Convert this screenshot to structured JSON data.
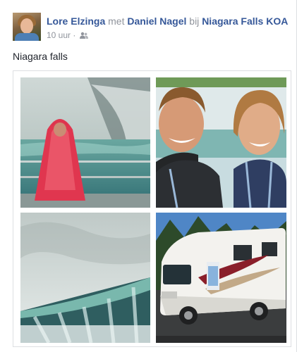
{
  "post": {
    "author": "Lore Elzinga",
    "with_word": "met",
    "tagged": "Daniel Nagel",
    "at_word": "bij",
    "location": "Niagara Falls KOA",
    "time": "10 uur",
    "separator": "·",
    "privacy_icon": "friends-icon",
    "caption": "Niagara falls"
  },
  "photos": [
    {
      "name": "photo-poncho-falls"
    },
    {
      "name": "photo-couple-selfie"
    },
    {
      "name": "photo-horseshoe-falls"
    },
    {
      "name": "photo-rv-camper"
    }
  ],
  "colors": {
    "link": "#365899",
    "meta": "#90949c",
    "text": "#1d2129",
    "border": "#dddfe2"
  }
}
